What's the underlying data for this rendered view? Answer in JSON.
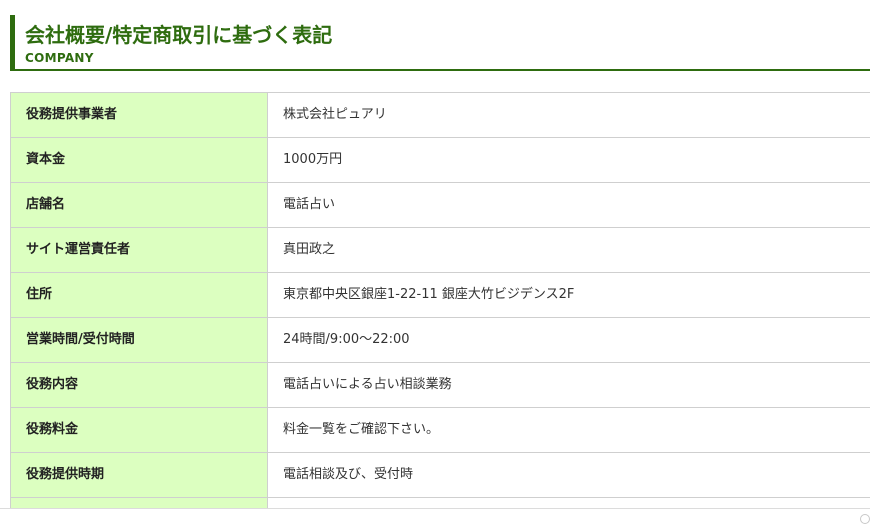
{
  "heading": {
    "title": "会社概要/特定商取引に基づく表記",
    "subtitle": "COMPANY"
  },
  "company_table": {
    "rows": [
      {
        "label": "役務提供事業者",
        "value": "株式会社ピュアリ"
      },
      {
        "label": "資本金",
        "value": "1000万円"
      },
      {
        "label": "店舗名",
        "value": "電話占い"
      },
      {
        "label": "サイト運営責任者",
        "value": "真田政之"
      },
      {
        "label": "住所",
        "value": "東京都中央区銀座1-22-11 銀座大竹ビジデンス2F"
      },
      {
        "label": "営業時間/受付時間",
        "value": "24時間/9:00～22:00"
      },
      {
        "label": "役務内容",
        "value": "電話占いによる占い相談業務"
      },
      {
        "label": "役務料金",
        "value": "料金一覧をご確認下さい。"
      },
      {
        "label": "役務提供時期",
        "value": "電話相談及び、受付時"
      },
      {
        "label": "",
        "value": ""
      }
    ]
  },
  "colors": {
    "accent": "#2e6c0f",
    "label_background": "#dcffc0",
    "border": "#cfcfcf"
  }
}
